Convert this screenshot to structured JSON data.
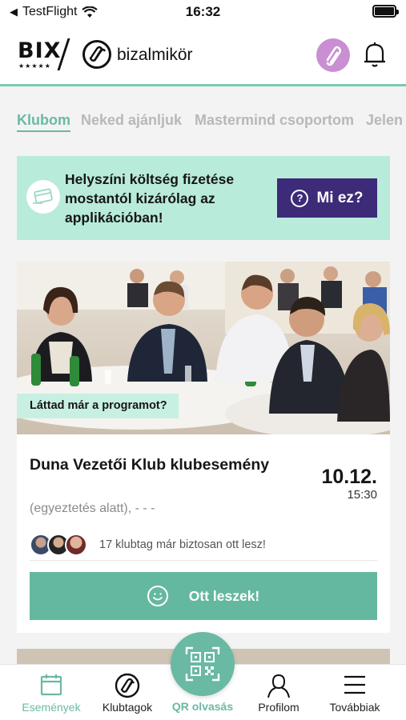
{
  "status_bar": {
    "back_app": "TestFlight",
    "time": "16:32"
  },
  "header": {
    "brand_bix": "BIX",
    "brand_stars": "★★★★★",
    "brand_name": "bizalmikör"
  },
  "tabs": [
    {
      "label": "Klubom",
      "active": true
    },
    {
      "label": "Neked ajánljuk",
      "active": false
    },
    {
      "label": "Mastermind csoportom",
      "active": false
    },
    {
      "label": "Jelen",
      "active": false
    }
  ],
  "banner": {
    "text": "Helyszíni költség fizetése mostantól kizárólag az applikációban!",
    "button_label": "Mi ez?",
    "button_icon": "?"
  },
  "event_card": {
    "photo_tag": "Láttad már a programot?",
    "title": "Duna Vezetői Klub klubesemény",
    "subtitle": "(egyeztetés alatt), - - -",
    "date": "10.12.",
    "time": "15:30",
    "members_note": "17 klubtag már biztosan ott lesz!",
    "cta_label": "Ott leszek!"
  },
  "bottom_nav": {
    "events": "Események",
    "club_members": "Klubtagok",
    "qr": "QR olvasás",
    "profile": "Profilom",
    "more": "Továbbiak"
  },
  "colors": {
    "accent": "#6ab9a4",
    "banner_bg": "#b9ebdb",
    "banner_button": "#3d2a78",
    "clip_button": "#c98fd2"
  }
}
